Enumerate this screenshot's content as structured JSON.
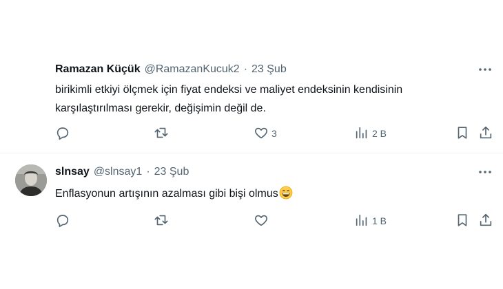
{
  "tweets": [
    {
      "author_name": "Ramazan Küçük",
      "handle": "@RamazanKucuk2",
      "separator": "·",
      "date": "23 Şub",
      "text": "birikimli etkiyi ölçmek için fiyat endeksi ve maliyet endeksinin kendisinin karşılaştırılması gerekir, değişimin değil de.",
      "likes": "3",
      "views": "2 B",
      "icons": [
        "reply-icon",
        "retweet-icon",
        "like-icon",
        "views-icon",
        "bookmark-icon",
        "share-icon",
        "more-icon"
      ]
    },
    {
      "author_name": "slnsay",
      "handle": "@slnsay1",
      "separator": "·",
      "date": "23 Şub",
      "text": "Enflasyonun artışının azalması gibi bişi olmus",
      "text_emoji": "grinning-face-emoji",
      "likes": "",
      "views": "1 B",
      "icons": [
        "reply-icon",
        "retweet-icon",
        "like-icon",
        "views-icon",
        "bookmark-icon",
        "share-icon",
        "more-icon"
      ]
    }
  ],
  "colors": {
    "text": "#0f1419",
    "secondary": "#536471",
    "divider": "#eff3f4",
    "background": "#ffffff"
  }
}
